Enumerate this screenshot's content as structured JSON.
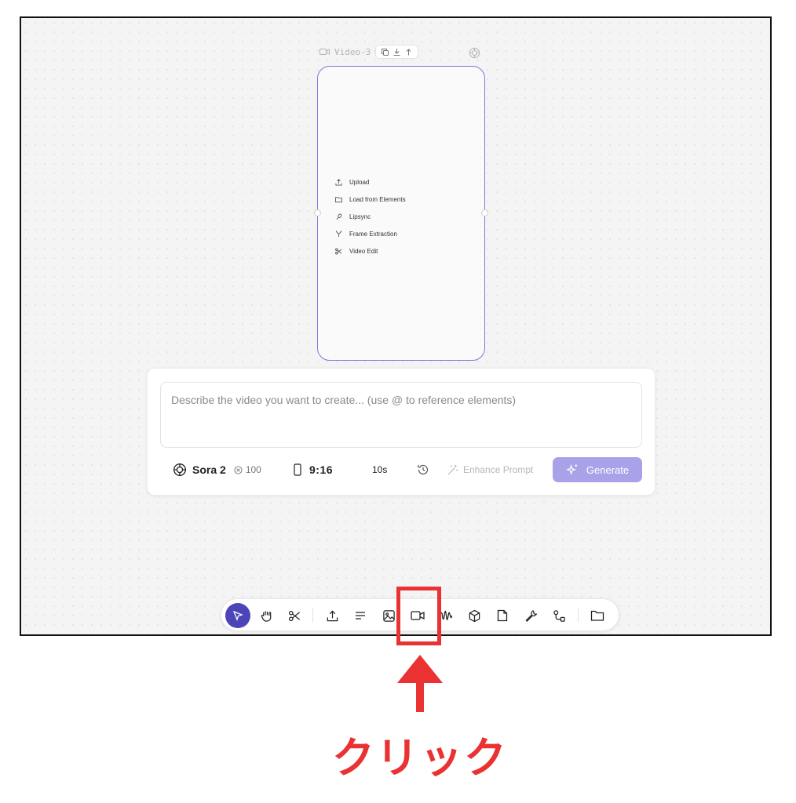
{
  "node": {
    "title": "Video-3",
    "title_icon": "video-icon",
    "toolbar_icons": [
      "copy-icon",
      "download-icon",
      "upload-icon"
    ],
    "model_badge_icon": "openai-icon",
    "menu": [
      {
        "icon": "upload-icon",
        "label": "Upload"
      },
      {
        "icon": "folder-icon",
        "label": "Load from Elements"
      },
      {
        "icon": "lipsync-icon",
        "label": "Lipsync"
      },
      {
        "icon": "frame-extraction-icon",
        "label": "Frame Extraction"
      },
      {
        "icon": "scissors-icon",
        "label": "Video Edit"
      }
    ],
    "border_color": "#7f77d9"
  },
  "prompt": {
    "placeholder": "Describe the video you want to create... (use @ to reference elements)",
    "value": "",
    "model": {
      "icon": "openai-icon",
      "name": "Sora 2",
      "credits": "100"
    },
    "aspect_ratio": "9:16",
    "duration": "10s",
    "enhance_label": "Enhance Prompt",
    "generate_label": "Generate",
    "generate_color": "#a9a2e8"
  },
  "toolbar": {
    "tools": [
      {
        "icon": "select-cursor-icon",
        "active": true
      },
      {
        "icon": "hand-icon"
      },
      {
        "icon": "scissors-icon"
      },
      {
        "icon": "upload-icon"
      },
      {
        "icon": "text-icon"
      },
      {
        "icon": "image-icon"
      },
      {
        "icon": "video-icon"
      },
      {
        "icon": "audio-wave-icon"
      },
      {
        "icon": "cube-icon"
      },
      {
        "icon": "note-icon"
      },
      {
        "icon": "wrench-icon"
      },
      {
        "icon": "workflow-icon"
      },
      {
        "icon": "folder-icon"
      }
    ],
    "active_color": "#4b45b7"
  },
  "annotation": {
    "label": "クリック",
    "color": "#ea3232"
  }
}
